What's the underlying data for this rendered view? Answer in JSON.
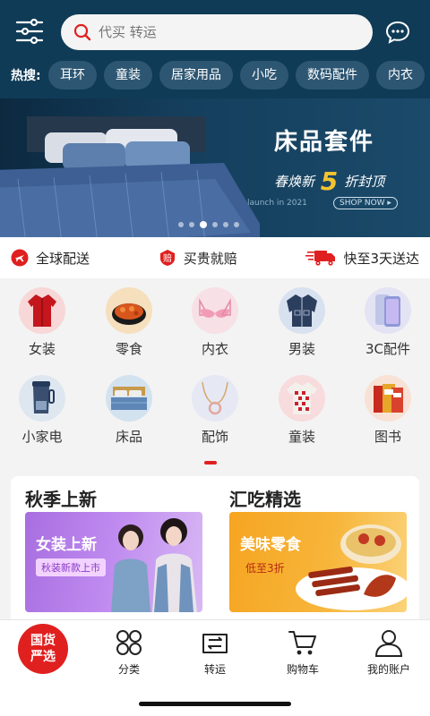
{
  "header": {
    "search_placeholder": "代买 转运",
    "hot_label": "热搜:",
    "hot_tags": [
      "耳环",
      "童装",
      "居家用品",
      "小吃",
      "数码配件",
      "内衣"
    ]
  },
  "banner": {
    "title": "床品套件",
    "subtitle_prefix": "春焕新",
    "subtitle_number": "5",
    "subtitle_suffix": "折封顶",
    "foot_text": "launch in 2021",
    "shop_now": "SHOP NOW ▸",
    "slide_count": 6,
    "active_slide": 3
  },
  "services": [
    {
      "icon": "plane-icon",
      "label": "全球配送"
    },
    {
      "icon": "compensation-icon",
      "label": "买贵就赔"
    },
    {
      "icon": "truck-icon",
      "label": "快至3天送达"
    }
  ],
  "categories": [
    {
      "label": "女装",
      "icon": "womens-wear-icon",
      "color": "#f7d7d7"
    },
    {
      "label": "零食",
      "icon": "snacks-icon",
      "color": "#f6dfbd"
    },
    {
      "label": "内衣",
      "icon": "lingerie-icon",
      "color": "#f7e0e6"
    },
    {
      "label": "男装",
      "icon": "mens-wear-icon",
      "color": "#d8e1ef"
    },
    {
      "label": "3C配件",
      "icon": "phone-accessory-icon",
      "color": "#e4e3f4"
    },
    {
      "label": "小家电",
      "icon": "appliance-icon",
      "color": "#dee7f0"
    },
    {
      "label": "床品",
      "icon": "bedding-icon",
      "color": "#d3e2ef"
    },
    {
      "label": "配饰",
      "icon": "necklace-icon",
      "color": "#e6e9f4"
    },
    {
      "label": "童装",
      "icon": "kids-wear-icon",
      "color": "#f7dbdd"
    },
    {
      "label": "图书",
      "icon": "books-icon",
      "color": "#f8e2d6"
    }
  ],
  "promos": [
    {
      "title": "秋季上新",
      "image_title": "女装上新",
      "image_badge": "秋装新款上市"
    },
    {
      "title": "汇吃精选",
      "image_title": "美味零食",
      "image_badge": "低至3折"
    }
  ],
  "tabbar": {
    "home_badge_line1": "国货",
    "home_badge_line2": "严选",
    "tabs": [
      "分类",
      "转运",
      "购物车",
      "我的账户"
    ]
  },
  "colors": {
    "header_bg": "#0f3b57",
    "accent_red": "#e0201f",
    "banner_highlight": "#f4c430"
  }
}
